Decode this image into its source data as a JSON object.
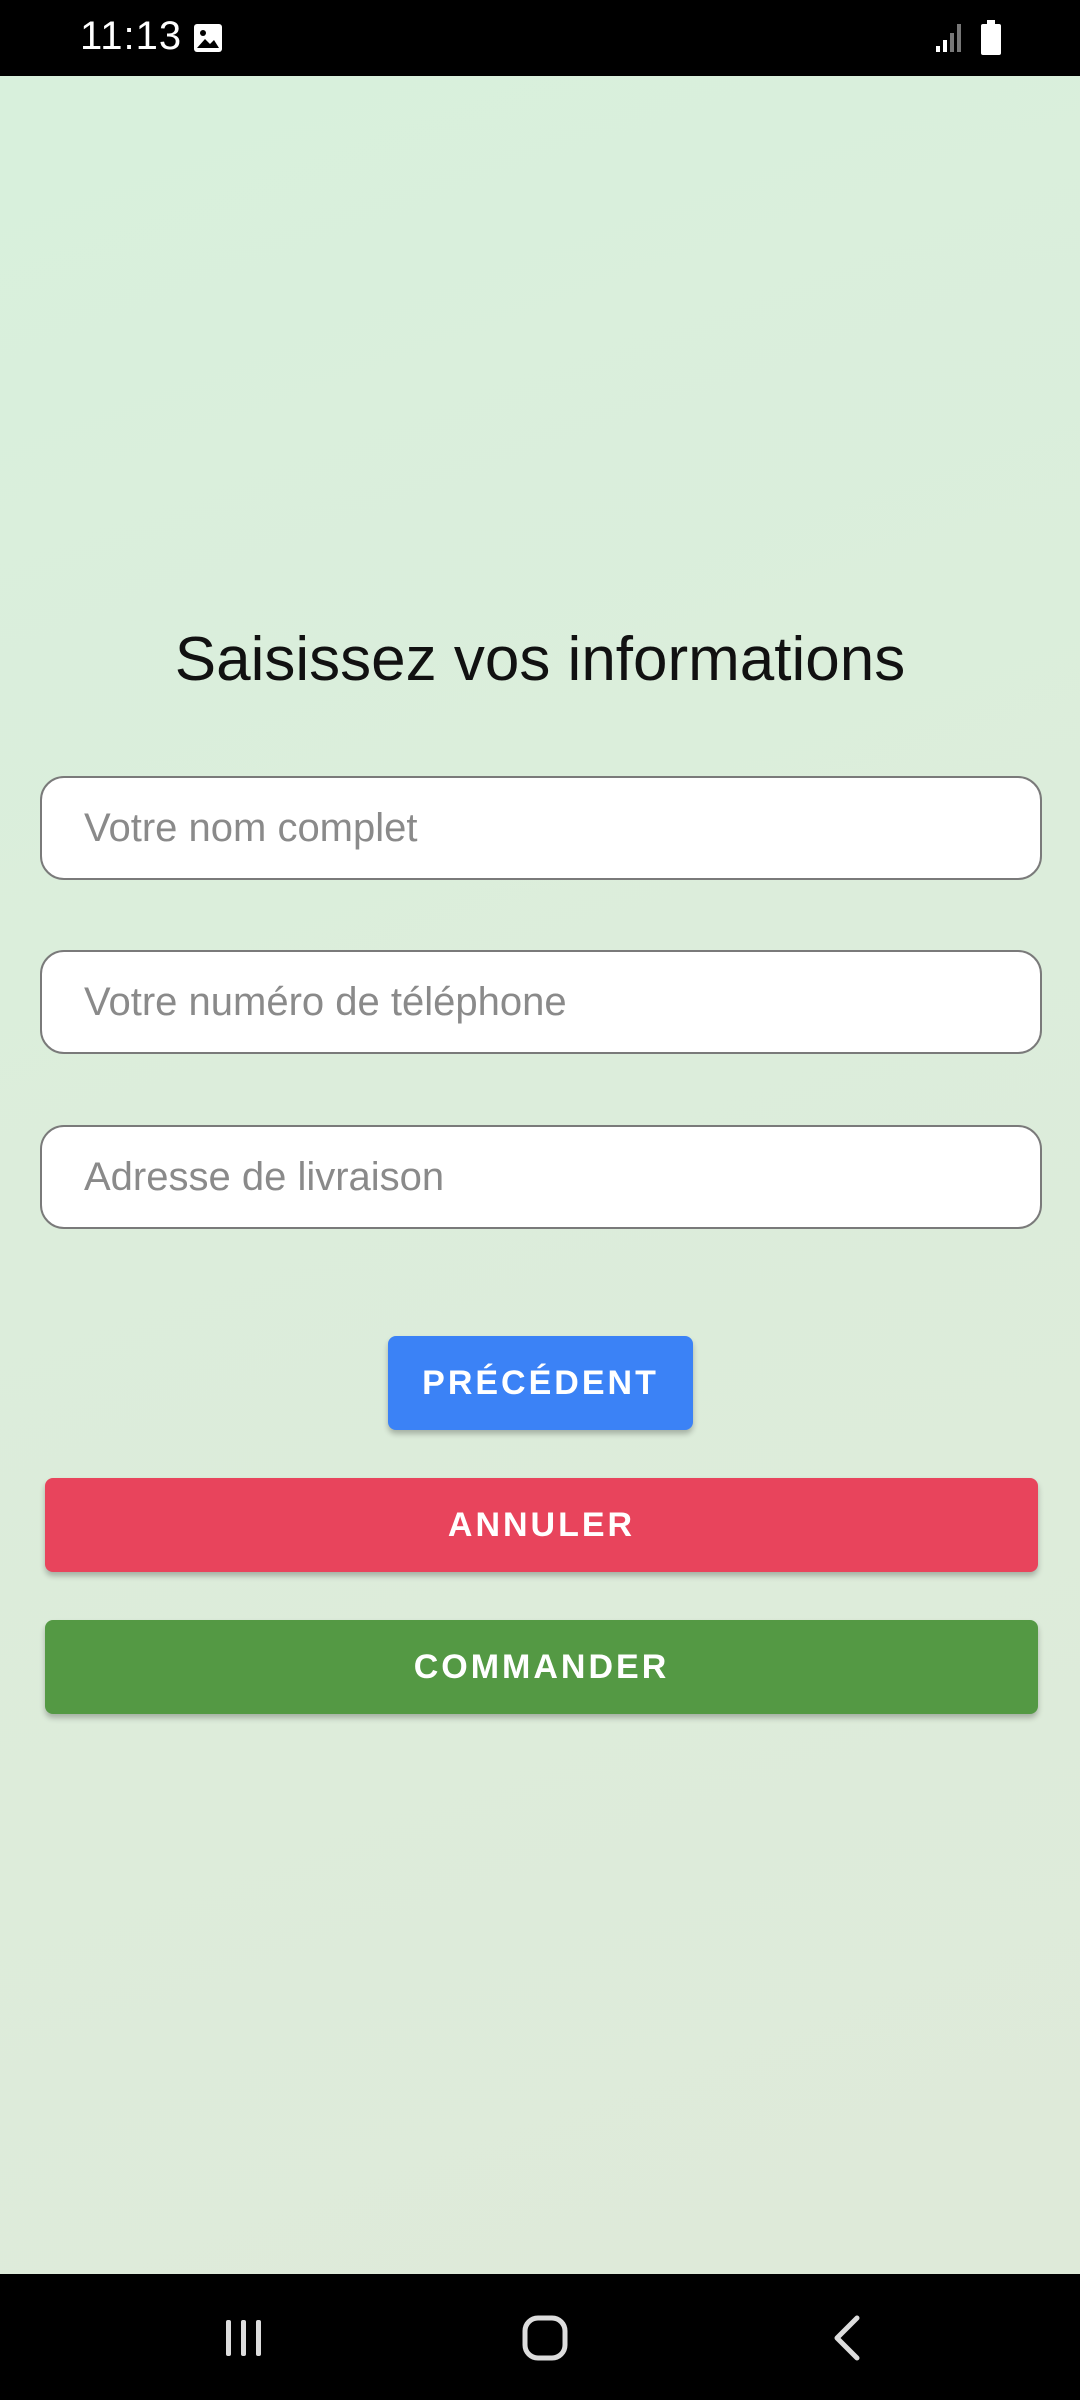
{
  "status_bar": {
    "time": "11:13",
    "icons": [
      "gallery-icon",
      "signal-icon",
      "battery-icon"
    ]
  },
  "form": {
    "title": "Saisissez vos informations",
    "fields": {
      "name_placeholder": "Votre nom complet",
      "phone_placeholder": "Votre numéro de téléphone",
      "address_placeholder": "Adresse de livraison",
      "name_value": "",
      "phone_value": "",
      "address_value": ""
    },
    "buttons": {
      "previous": "PRÉCÉDENT",
      "cancel": "ANNULER",
      "order": "COMMANDER"
    }
  },
  "nav_bar": {
    "icons": [
      "recents-icon",
      "home-icon",
      "back-icon"
    ]
  },
  "colors": {
    "background": "#dceddb",
    "previous_button": "#3b82f6",
    "cancel_button": "#e8445c",
    "order_button": "#549944"
  }
}
